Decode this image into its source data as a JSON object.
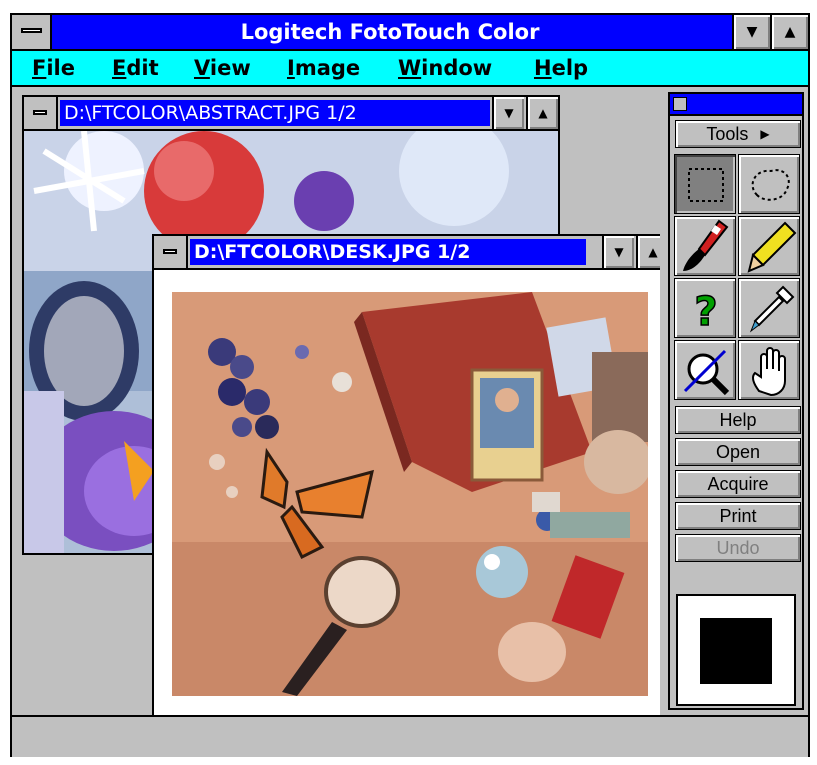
{
  "app": {
    "title": "Logitech FotoTouch Color",
    "menu": [
      {
        "label": "File",
        "mnemonic": "F",
        "rest": "ile"
      },
      {
        "label": "Edit",
        "mnemonic": "E",
        "rest": "dit"
      },
      {
        "label": "View",
        "mnemonic": "V",
        "rest": "iew"
      },
      {
        "label": "Image",
        "mnemonic": "I",
        "rest": "mage"
      },
      {
        "label": "Window",
        "mnemonic": "W",
        "rest": "indow"
      },
      {
        "label": "Help",
        "mnemonic": "H",
        "rest": "elp"
      }
    ],
    "minimize_glyph": "▼",
    "maximize_glyph": "▲"
  },
  "windows": {
    "abstract": {
      "title": "D:\\FTCOLOR\\ABSTRACT.JPG 1/2"
    },
    "desk": {
      "title": "D:\\FTCOLOR\\DESK.JPG 1/2"
    }
  },
  "tools": {
    "menu_label": "Tools",
    "menu_arrow": "▶",
    "items": [
      {
        "name": "rectangle-select-tool",
        "pressed": true
      },
      {
        "name": "lasso-select-tool",
        "pressed": false
      },
      {
        "name": "paintbrush-tool",
        "pressed": false
      },
      {
        "name": "pencil-tool",
        "pressed": false
      },
      {
        "name": "help-question-tool",
        "pressed": false
      },
      {
        "name": "eyedropper-tool",
        "pressed": false
      },
      {
        "name": "magnifier-tool",
        "pressed": false
      },
      {
        "name": "hand-pan-tool",
        "pressed": false
      }
    ],
    "buttons": {
      "help": "Help",
      "open": "Open",
      "acquire": "Acquire",
      "print": "Print",
      "undo": "Undo"
    },
    "current_color": "#000000"
  },
  "colors": {
    "title_active": "#0000ff",
    "menubar": "#00ffff",
    "chrome": "#c0c0c0"
  }
}
